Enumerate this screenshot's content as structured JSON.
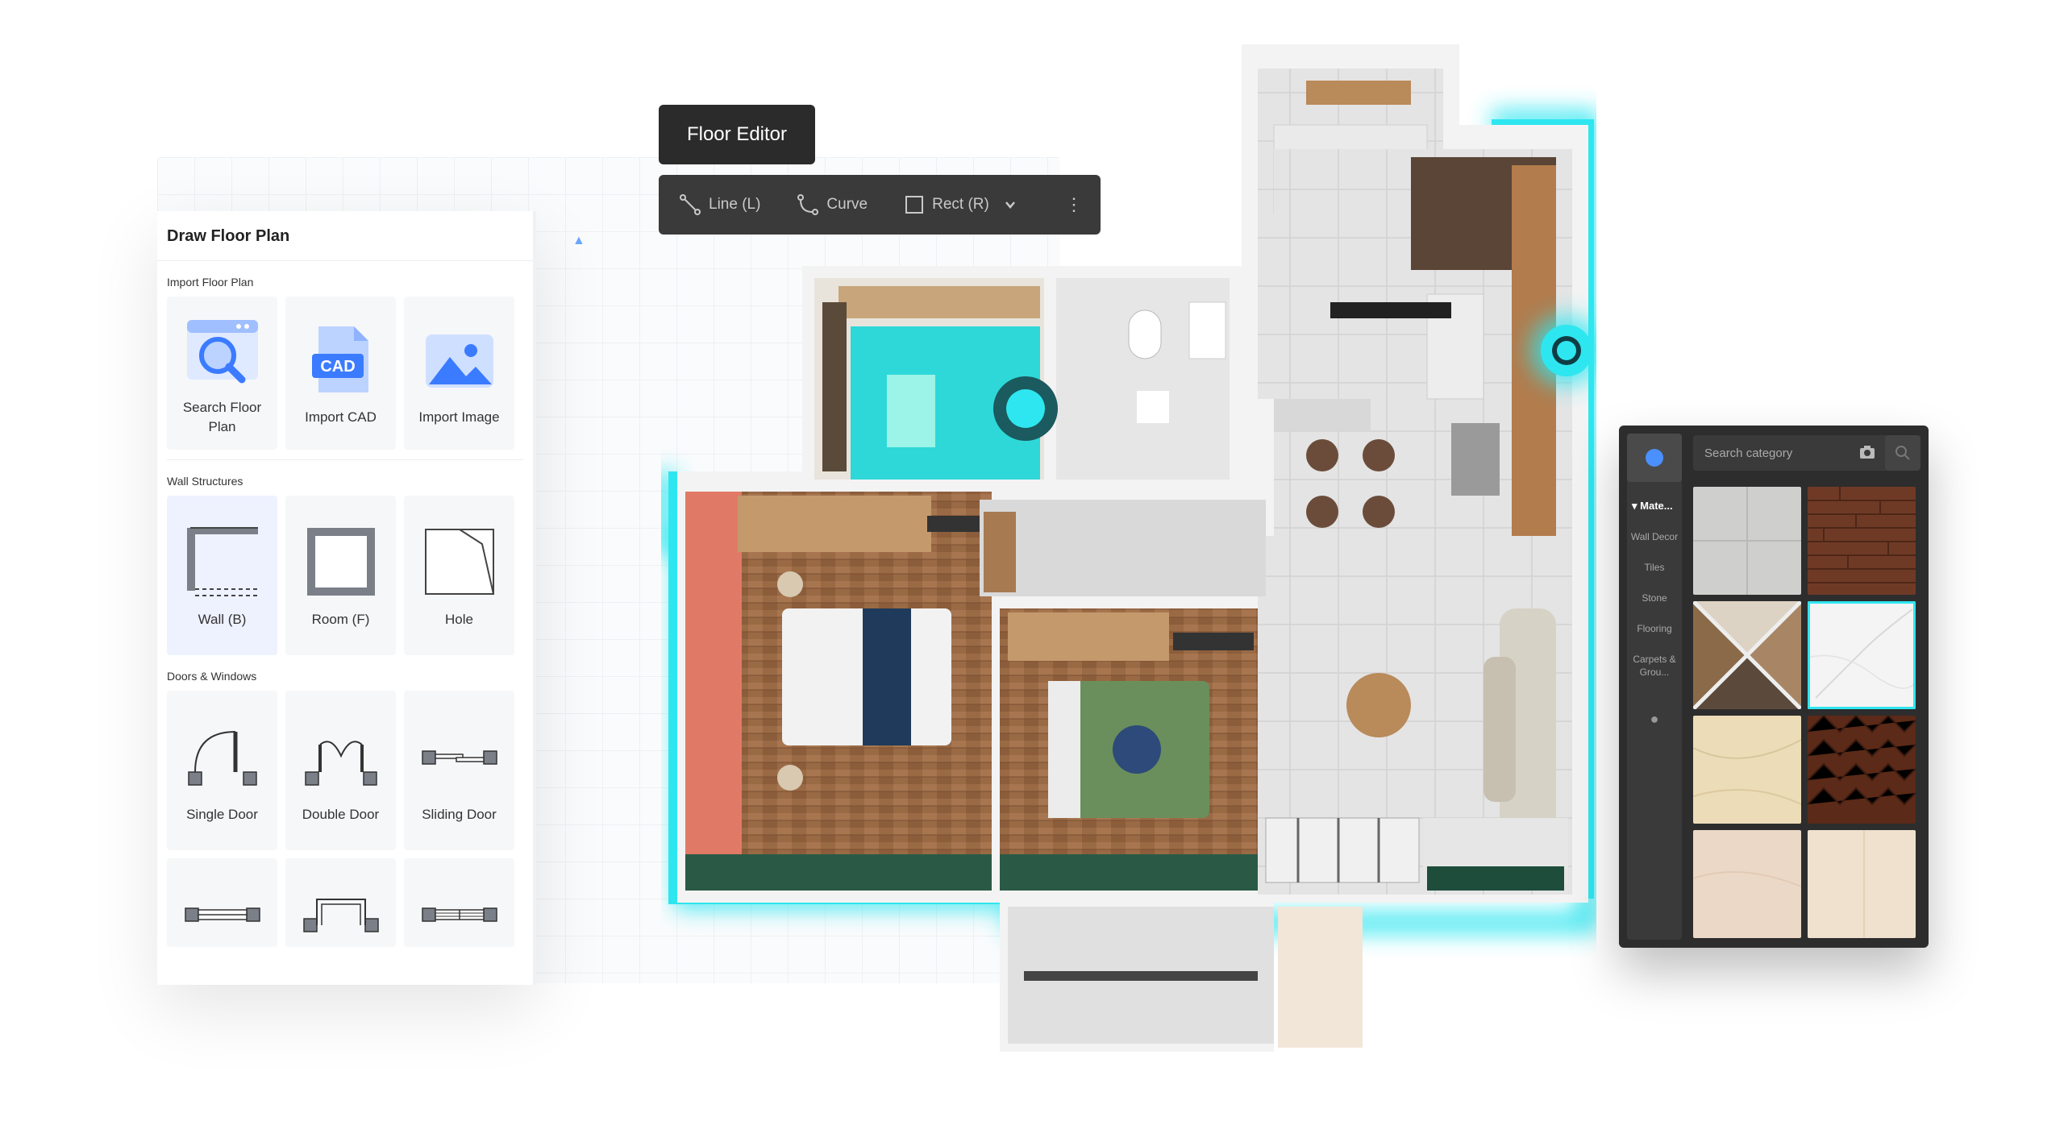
{
  "editor": {
    "title": "Floor Editor",
    "tools": [
      {
        "label": "Line (L)",
        "icon": "line-icon"
      },
      {
        "label": "Curve",
        "icon": "curve-icon"
      },
      {
        "label": "Rect (R)",
        "icon": "rect-icon"
      }
    ],
    "more_icon": "⋮"
  },
  "left_panel": {
    "title": "Draw Floor Plan",
    "import_section": {
      "title": "Import Floor Plan",
      "items": [
        "Search Floor Plan",
        "Import CAD",
        "Import Image"
      ],
      "cad_badge": "CAD"
    },
    "wall_section": {
      "title": "Wall Structures",
      "items": [
        "Wall (B)",
        "Room (F)",
        "Hole"
      ]
    },
    "doors_section": {
      "title": "Doors & Windows",
      "items": [
        "Single Door",
        "Double Door",
        "Sliding Door"
      ]
    }
  },
  "material_panel": {
    "search_placeholder": "Search category",
    "active_category": "Mate...",
    "categories": [
      "Wall Decor",
      "Tiles",
      "Stone",
      "Flooring",
      "Carpets & Grou..."
    ]
  },
  "colors": {
    "accent_cyan": "#2ee6f0",
    "toolbar_bg": "#3a3a3a",
    "panel_dark": "#2d2d2d"
  }
}
